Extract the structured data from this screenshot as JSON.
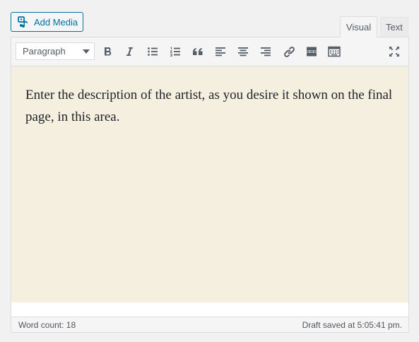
{
  "media": {
    "add_media_label": "Add Media"
  },
  "tabs": {
    "visual_label": "Visual",
    "text_label": "Text",
    "active": "Visual"
  },
  "toolbar": {
    "format_value": "Paragraph",
    "buttons": [
      "bold-icon",
      "italic-icon",
      "bulleted-list-icon",
      "numbered-list-icon",
      "blockquote-icon",
      "align-left-icon",
      "align-center-icon",
      "align-right-icon",
      "insert-link-icon",
      "read-more-icon",
      "toolbar-toggle-icon",
      "fullscreen-icon"
    ]
  },
  "editor": {
    "content": "Enter the description of the artist, as you desire it shown on the final page, in this area."
  },
  "status": {
    "word_count": "Word count: 18",
    "draft_saved": "Draft saved at 5:05:41 pm."
  },
  "colors": {
    "accent": "#0071a1",
    "editor_background": "#f5efe0",
    "toolbar_background": "#f5f5f5",
    "border": "#dcdcde"
  }
}
